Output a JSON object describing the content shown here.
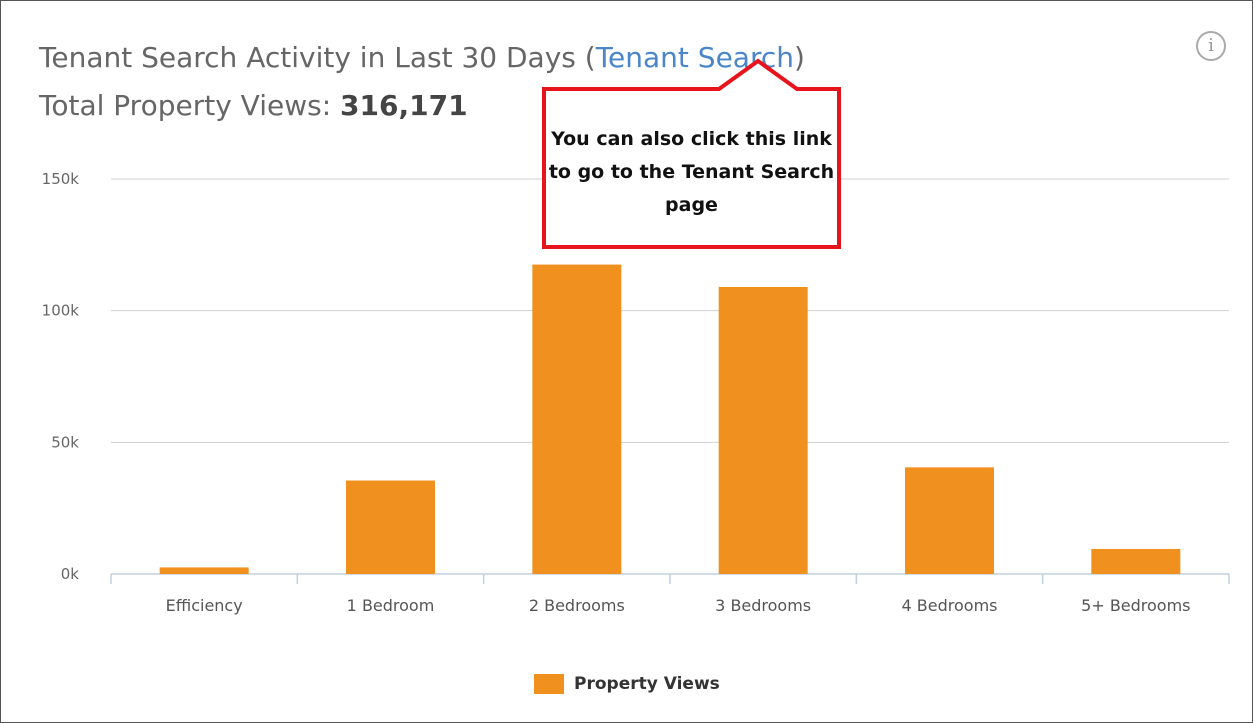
{
  "header": {
    "title_prefix": "Tenant Search Activity in Last 30 Days (",
    "title_link": "Tenant Search",
    "title_suffix": ")",
    "total_label": "Total Property Views: ",
    "total_value": "316,171",
    "info_icon": "info-icon",
    "info_glyph": "i"
  },
  "callout": {
    "text": "You can also click this link to go to the Tenant Search page",
    "border_color": "#e8141c"
  },
  "chart_data": {
    "type": "bar",
    "categories": [
      "Efficiency",
      "1 Bedroom",
      "2 Bedrooms",
      "3 Bedrooms",
      "4 Bedrooms",
      "5+ Bedrooms"
    ],
    "series": [
      {
        "name": "Property Views",
        "values": [
          2500,
          35500,
          117500,
          109000,
          40500,
          9500
        ],
        "color": "#f0901e"
      }
    ],
    "ylim": [
      0,
      150000
    ],
    "yticks": [
      0,
      50000,
      100000,
      150000
    ],
    "ytick_labels": [
      "0k",
      "50k",
      "100k",
      "150k"
    ],
    "grid": true,
    "legend": "bottom-center"
  }
}
